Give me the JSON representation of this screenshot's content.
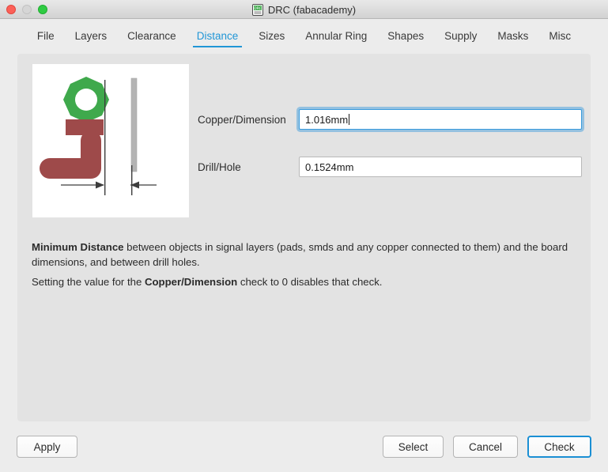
{
  "window": {
    "title": "DRC (fabacademy)",
    "app_icon": "drc-icon",
    "controls": {
      "close": "close-button",
      "minimize": "minimize-button",
      "maximize": "maximize-button"
    }
  },
  "tabs": [
    {
      "label": "File",
      "active": false
    },
    {
      "label": "Layers",
      "active": false
    },
    {
      "label": "Clearance",
      "active": false
    },
    {
      "label": "Distance",
      "active": true
    },
    {
      "label": "Sizes",
      "active": false
    },
    {
      "label": "Annular Ring",
      "active": false
    },
    {
      "label": "Shapes",
      "active": false
    },
    {
      "label": "Supply",
      "active": false
    },
    {
      "label": "Masks",
      "active": false
    },
    {
      "label": "Misc",
      "active": false
    }
  ],
  "preview": {
    "name": "distance-diagram",
    "colors": {
      "pad_green": "#3fa94c",
      "copper_red": "#9e4a4a",
      "edge_gray": "#b4b4b4",
      "line_dark": "#3d3d3d",
      "background": "#ffffff"
    }
  },
  "fields": [
    {
      "label": "Copper/Dimension",
      "value": "1.016mm",
      "placeholder": "",
      "focused": true
    },
    {
      "label": "Drill/Hole",
      "value": "0.1524mm",
      "placeholder": "",
      "focused": false
    }
  ],
  "description": {
    "line1_bold": "Minimum Distance",
    "line1_rest": " between objects in signal layers (pads, smds and any copper connected to them) and the board dimensions, and between drill holes.",
    "line2_pre": "Setting the value for the ",
    "line2_bold": "Copper/Dimension",
    "line2_post": " check to 0 disables that check."
  },
  "buttons": {
    "apply": "Apply",
    "select": "Select",
    "cancel": "Cancel",
    "check": "Check"
  },
  "accent_color": "#2196d6"
}
